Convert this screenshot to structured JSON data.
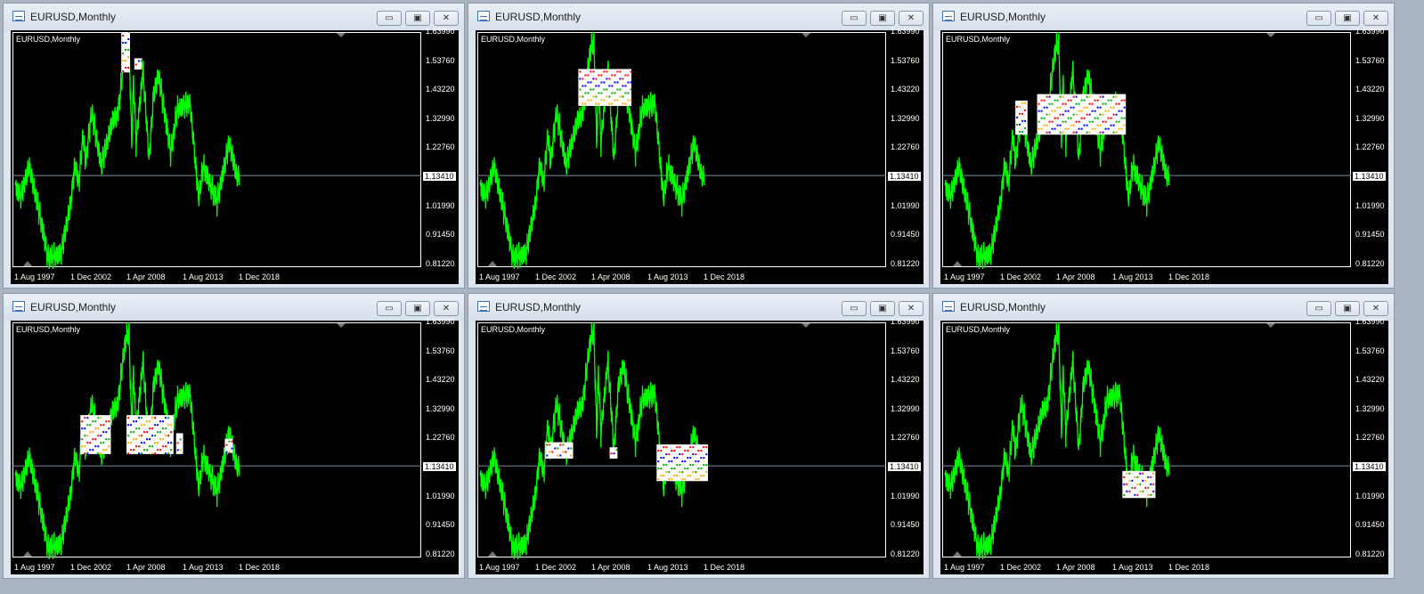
{
  "window_title": "EURUSD,Monthly",
  "chart_label": "EURUSD,Monthly",
  "window_buttons": {
    "minimize": "▭",
    "restore": "▣",
    "close": "✕"
  },
  "price_labels": [
    "1.63990",
    "1.53760",
    "1.43220",
    "1.32990",
    "1.22760",
    "1.13410",
    "1.01990",
    "0.91450",
    "0.81220"
  ],
  "bid_price": "1.13410",
  "date_labels": [
    "1 Aug 1997",
    "1 Dec 2002",
    "1 Apr 2008",
    "1 Aug 2013",
    "1 Dec 2018"
  ],
  "colors": {
    "line": "#00ff00",
    "bid_line": "#7a8ca0",
    "background": "#000000"
  },
  "chart_data": {
    "type": "line",
    "series_name": "EURUSD Monthly",
    "ylim": [
      0.8122,
      1.6399
    ],
    "x_start": "1997-08",
    "keypoints": [
      [
        "1997-08",
        1.09
      ],
      [
        "1998-03",
        1.06
      ],
      [
        "1998-12",
        1.17
      ],
      [
        "1999-12",
        1.0
      ],
      [
        "2000-10",
        0.84
      ],
      [
        "2001-07",
        0.85
      ],
      [
        "2002-01",
        0.86
      ],
      [
        "2002-12",
        1.04
      ],
      [
        "2003-05",
        1.18
      ],
      [
        "2003-09",
        1.1
      ],
      [
        "2004-02",
        1.28
      ],
      [
        "2004-05",
        1.18
      ],
      [
        "2004-12",
        1.36
      ],
      [
        "2005-11",
        1.17
      ],
      [
        "2006-12",
        1.33
      ],
      [
        "2007-06",
        1.35
      ],
      [
        "2007-11",
        1.49
      ],
      [
        "2008-04",
        1.6
      ],
      [
        "2008-07",
        1.6
      ],
      [
        "2008-10",
        1.25
      ],
      [
        "2008-12",
        1.47
      ],
      [
        "2009-03",
        1.25
      ],
      [
        "2009-11",
        1.51
      ],
      [
        "2010-06",
        1.19
      ],
      [
        "2010-11",
        1.42
      ],
      [
        "2011-05",
        1.49
      ],
      [
        "2012-07",
        1.21
      ],
      [
        "2013-02",
        1.37
      ],
      [
        "2014-05",
        1.39
      ],
      [
        "2015-03",
        1.05
      ],
      [
        "2015-08",
        1.17
      ],
      [
        "2016-12",
        1.04
      ],
      [
        "2018-02",
        1.25
      ],
      [
        "2018-11",
        1.13
      ],
      [
        "2019-02",
        1.134
      ]
    ]
  },
  "windows": [
    {
      "markers": [
        [
          122,
          132,
          1.5,
          1.64
        ],
        [
          137,
          146,
          1.51,
          1.55
        ]
      ]
    },
    {
      "markers": [
        [
          113,
          174,
          1.381,
          1.512
        ]
      ]
    },
    {
      "markers": [
        [
          81,
          95,
          1.279,
          1.4
        ],
        [
          106,
          208,
          1.279,
          1.423
        ]
      ]
    },
    {
      "markers": [
        [
          75,
          110,
          1.176,
          1.314
        ],
        [
          128,
          182,
          1.176,
          1.314
        ],
        [
          185,
          193,
          1.176,
          1.25
        ],
        [
          241,
          250,
          1.18,
          1.23
        ]
      ]
    },
    {
      "markers": [
        [
          75,
          107,
          1.16,
          1.218
        ],
        [
          149,
          158,
          1.16,
          1.2
        ],
        [
          203,
          262,
          1.08,
          1.21
        ]
      ]
    },
    {
      "markers": [
        [
          204,
          242,
          1.02,
          1.116
        ]
      ]
    }
  ]
}
